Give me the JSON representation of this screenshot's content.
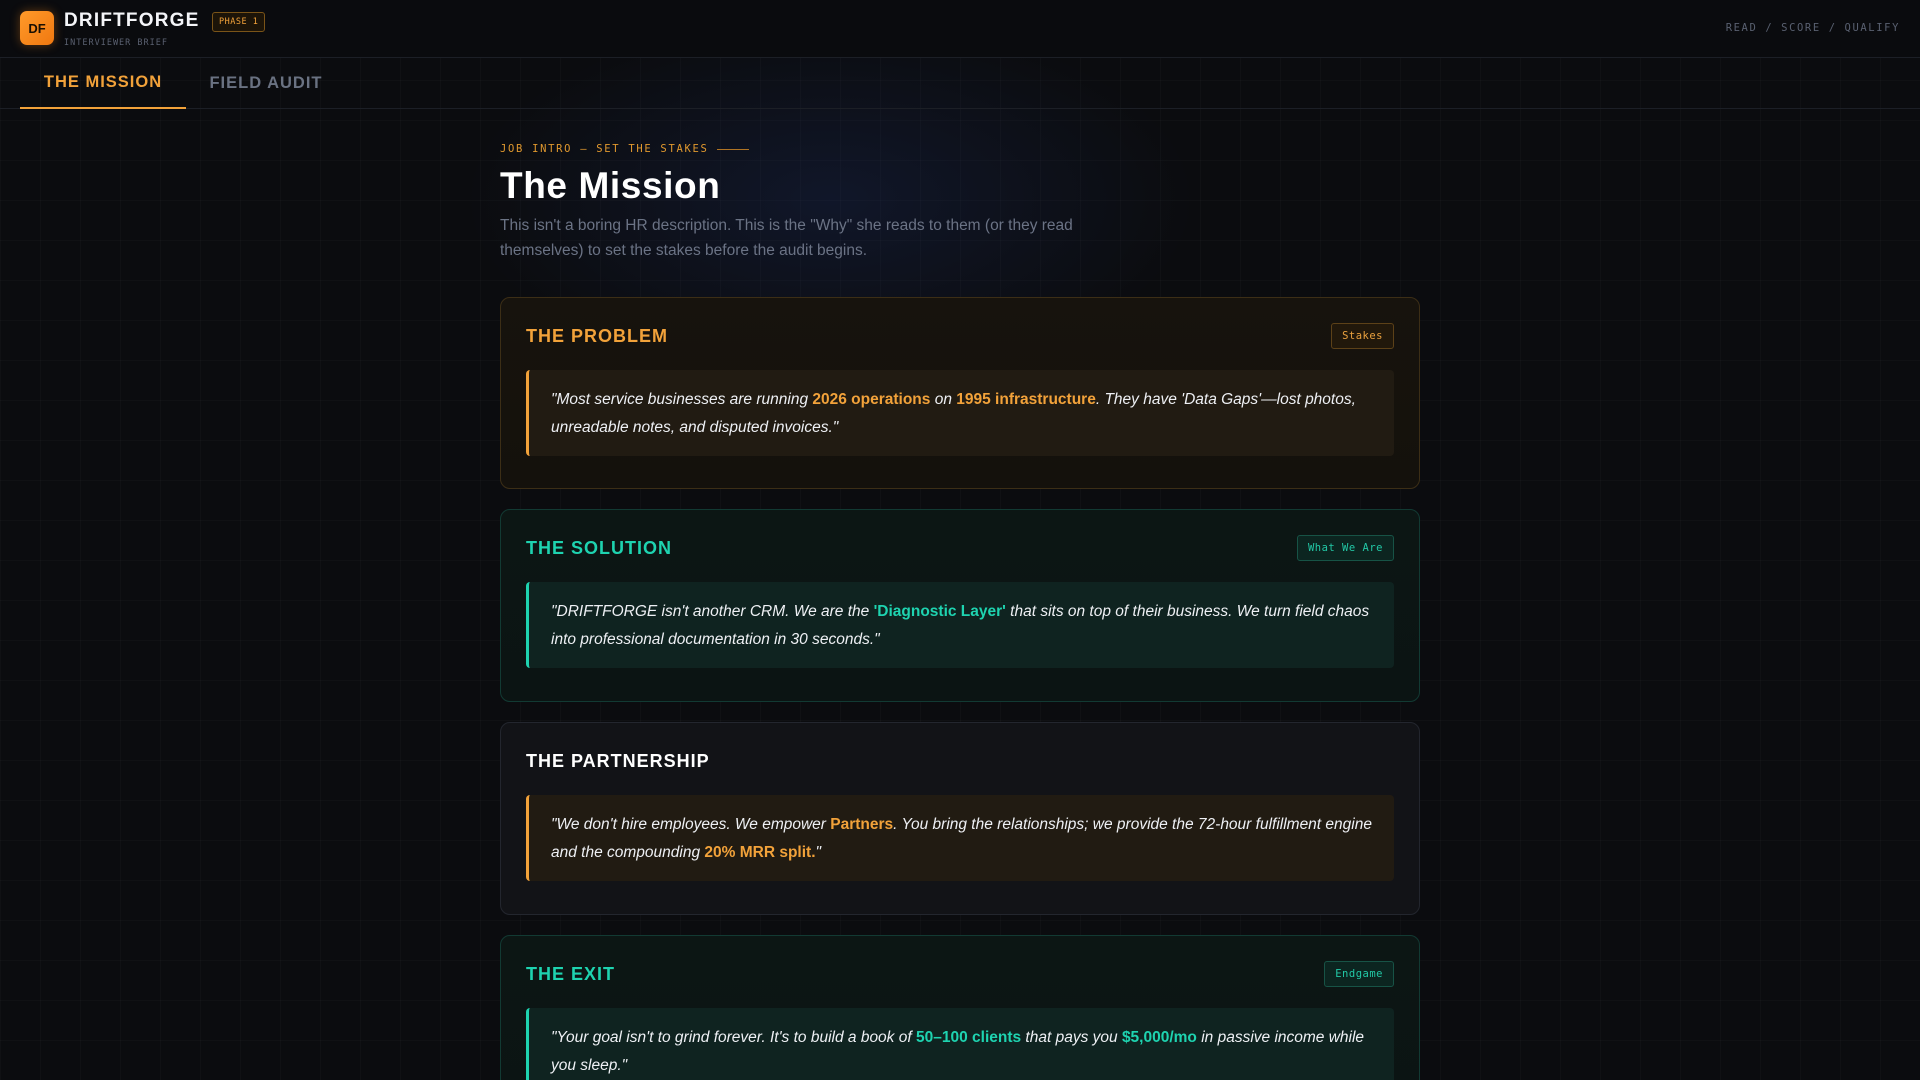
{
  "header": {
    "logo": "DF",
    "brand": "DRIFTFORGE",
    "phase": "PHASE 1",
    "subtitle": "INTERVIEWER BRIEF",
    "right_label": "READ / SCORE / QUALIFY"
  },
  "tabs": [
    {
      "label": "THE MISSION",
      "active": true
    },
    {
      "label": "FIELD AUDIT",
      "active": false
    }
  ],
  "intro": {
    "eyebrow": "JOB INTRO — SET THE STAKES",
    "title": "The Mission",
    "description": "This isn't a boring HR description. This is the \"Why\" she reads to them (or they read themselves) to set the stakes before the audit begins."
  },
  "cards": [
    {
      "title": "THE PROBLEM",
      "tag": "Stakes",
      "accent": "#f2a23a",
      "quote": {
        "p1": "\"Most service businesses are running ",
        "h1": "2026 operations",
        "p2": " on ",
        "h2": "1995 infrastructure",
        "p3": ". They have 'Data Gaps'—lost photos, unreadable notes, and disputed invoices.\""
      }
    },
    {
      "title": "THE SOLUTION",
      "tag": "What We Are",
      "accent": "#1ed3b0",
      "quote": {
        "p1": "\"DRIFTFORGE isn't another CRM. We are the ",
        "h1": "'Diagnostic Layer'",
        "p2": " that sits on top of their business. We turn field chaos into professional documentation in 30 seconds.\""
      }
    },
    {
      "title": "THE PARTNERSHIP",
      "accent": "#f2a23a",
      "quote": {
        "p1": "\"We don't hire employees. We empower ",
        "h1": "Partners",
        "p2": ". You bring the relationships; we provide the 72-hour fulfillment engine and the compounding ",
        "h2": "20% MRR split.",
        "p3": "\""
      }
    },
    {
      "title": "THE EXIT",
      "tag": "Endgame",
      "accent": "#1ed3b0",
      "quote": {
        "p1": "\"Your goal isn't to grind forever. It's to build a book of ",
        "h1": "50–100 clients",
        "p2": " that pays you ",
        "h2": "$5,000/mo",
        "p3": " in passive income while you sleep.\""
      }
    }
  ]
}
